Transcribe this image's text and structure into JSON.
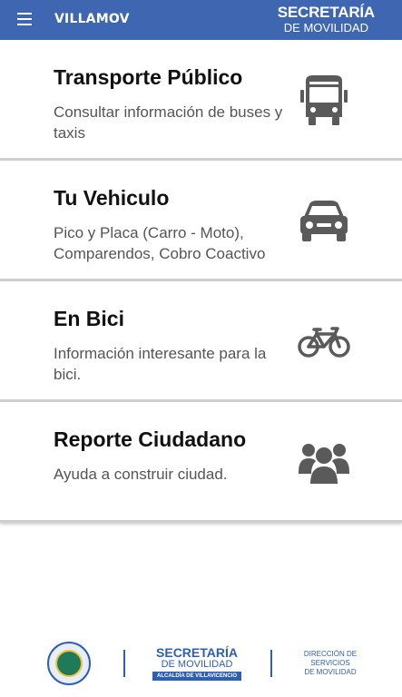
{
  "appbar": {
    "menu_icon": "menu-icon",
    "title": "VILLAMOV",
    "brand_line1": "SECRETARÍA",
    "brand_line2": "DE MOVILIDAD",
    "bg_color": "#3f67b1"
  },
  "cards": [
    {
      "title": "Transporte Público",
      "description": "Consultar información de buses y taxis",
      "icon": "bus-icon"
    },
    {
      "title": "Tu Vehiculo",
      "description": "Pico y Placa (Carro - Moto), Comparendos, Cobro Coactivo",
      "icon": "car-icon"
    },
    {
      "title": "En Bici",
      "description": "Información interesante para la bici.",
      "icon": "bicycle-icon"
    },
    {
      "title": "Reporte Ciudadano",
      "description": "Ayuda a construir ciudad.",
      "icon": "users-icon"
    }
  ],
  "footer": {
    "seal_icon": "city-seal-logo",
    "brand_line1": "SECRETARÍA",
    "brand_line2": "DE MOVILIDAD",
    "brand_line3": "ALCALDÍA DE VILLAVICENCIO",
    "dir_line1": "DIRECCIÓN DE",
    "dir_line2": "SERVICIOS",
    "dir_line3": "DE MOVILIDAD"
  }
}
